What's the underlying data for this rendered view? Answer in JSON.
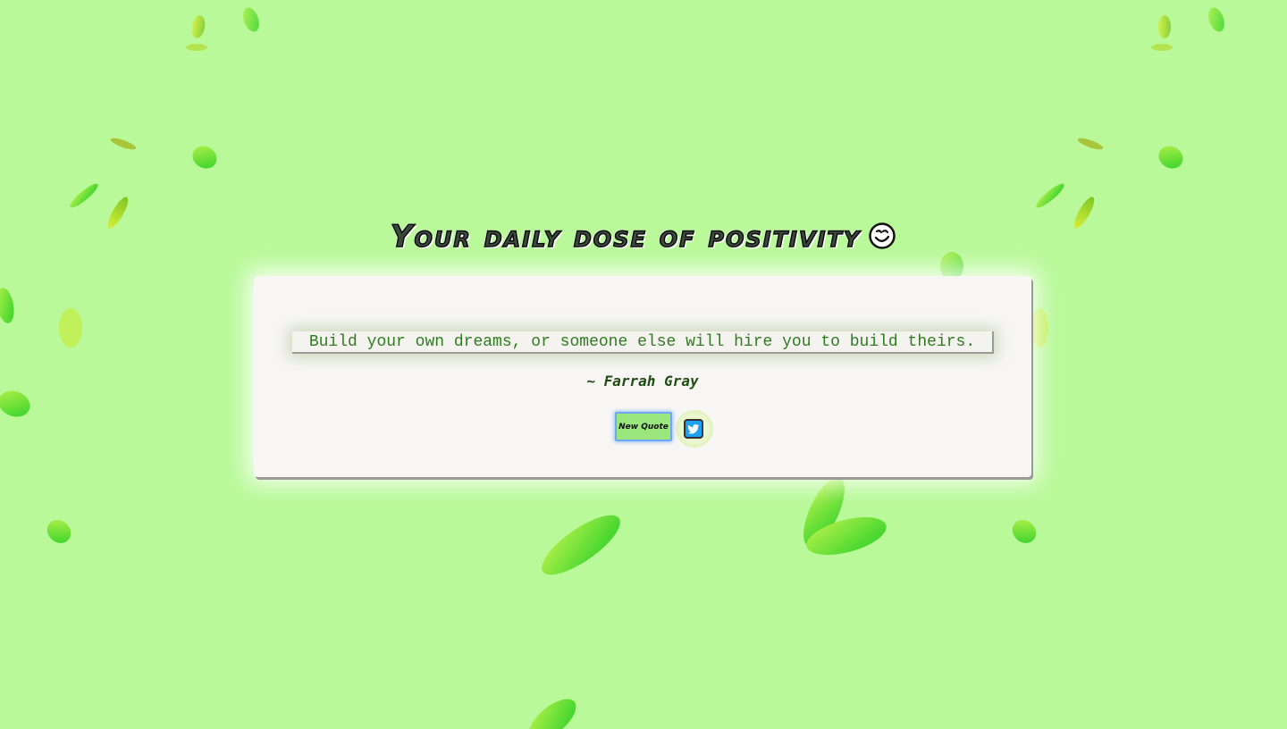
{
  "page": {
    "title": "Your daily dose of positivity",
    "title_icon": "smiley-face-icon"
  },
  "quote": {
    "text": "Build your own dreams, or someone else will hire you to build theirs.",
    "author": "~ Farrah Gray"
  },
  "actions": {
    "new_quote_label": "New Quote",
    "tweet_icon": "twitter-bird-icon"
  },
  "colors": {
    "background": "#b9f999",
    "card": "#f7f6f4",
    "quote_text": "#2e7d1e",
    "author_text": "#1f4d14",
    "button_fill": "#9be77e",
    "button_border": "#6fa8f5",
    "twitter_blue": "#1da1f2"
  }
}
